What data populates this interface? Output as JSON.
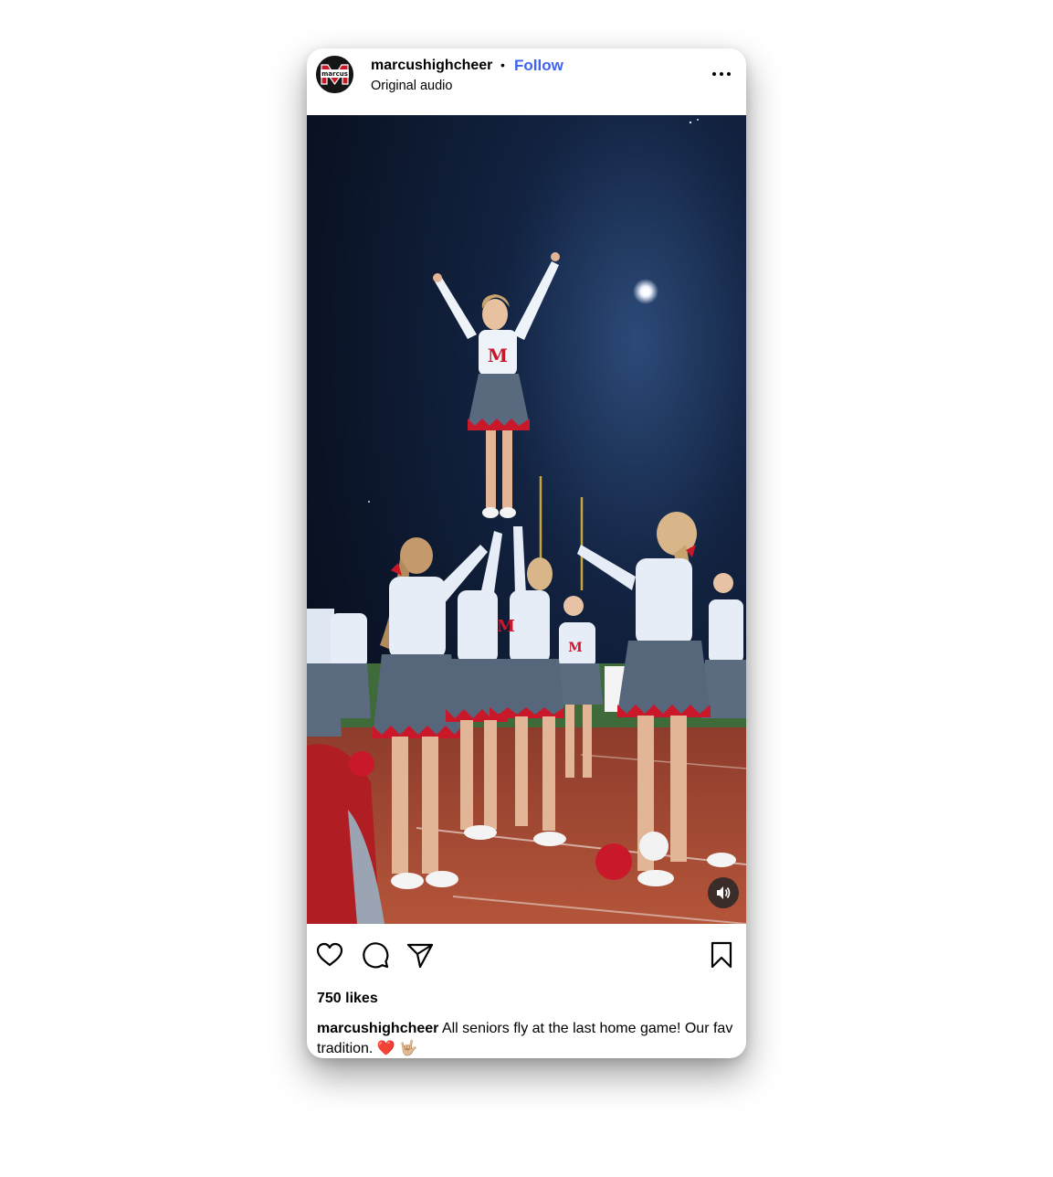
{
  "post": {
    "username": "marcushighcheer",
    "separator": "•",
    "follow_label": "Follow",
    "audio_label": "Original audio",
    "avatar_text": "marcus",
    "likes": "750 likes",
    "caption_username": "marcushighcheer",
    "caption_text": "All seniors fly at the last home game! Our fav tradition.",
    "caption_emoji": "❤️ 🤟🏼"
  },
  "icons": {
    "more": "more-options-icon",
    "like": "heart-icon",
    "comment": "comment-icon",
    "share": "share-icon",
    "save": "bookmark-icon",
    "sound": "speaker-icon"
  },
  "colors": {
    "follow": "#3f63ef",
    "uniform_red": "#c8182a",
    "uniform_gray": "#5a6a7e",
    "night_sky": "#0c1628",
    "track": "#a84a33"
  }
}
